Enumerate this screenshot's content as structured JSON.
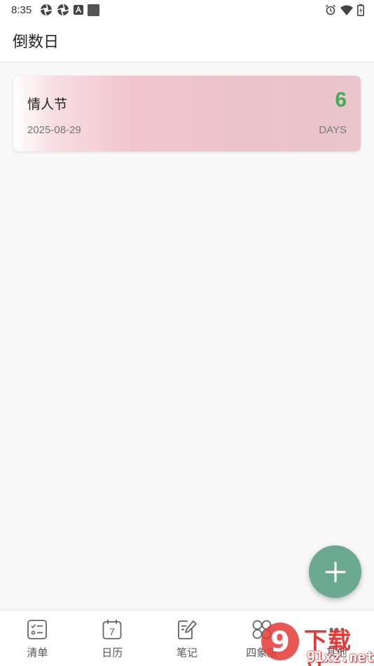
{
  "status_bar": {
    "time": "8:35",
    "left_icons": [
      "aperture-icon",
      "aperture-icon",
      "font-a-icon",
      "square-icon"
    ],
    "right_icons": [
      "alarm-icon",
      "wifi-icon",
      "battery-icon"
    ]
  },
  "header": {
    "title": "倒数日"
  },
  "countdown_card": {
    "title": "情人节",
    "date": "2025-08-29",
    "days": "6",
    "unit": "DAYS"
  },
  "fab": {
    "icon": "plus-icon"
  },
  "bottom_nav": {
    "items": [
      {
        "label": "清单",
        "icon": "checklist-icon"
      },
      {
        "label": "日历",
        "icon": "calendar-icon",
        "calendar_day": "7"
      },
      {
        "label": "笔记",
        "icon": "note-edit-icon"
      },
      {
        "label": "四象限",
        "icon": "quadrant-icon"
      },
      {
        "label": "其他",
        "icon": "more-icon"
      }
    ]
  },
  "watermark": {
    "text": "下载站",
    "domain": "91xz.net",
    "logo_glyph": "9"
  },
  "colors": {
    "accent_green": "#3fae55",
    "fab": "#6aa891",
    "card_pink": "#f1c4cc",
    "watermark_red": "#e53935"
  }
}
